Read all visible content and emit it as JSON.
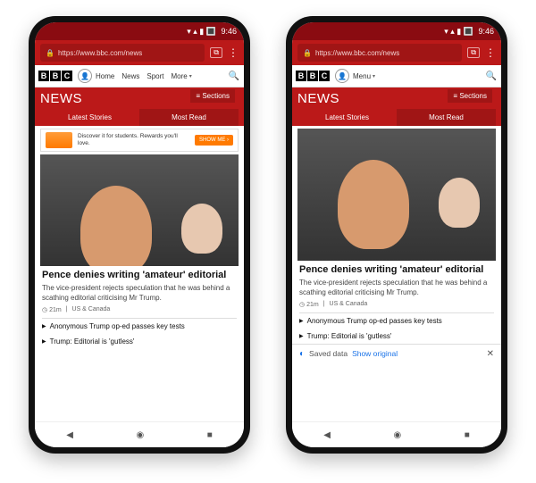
{
  "status": {
    "time": "9:46",
    "icons": "▾ ▴ ▮ 🔳"
  },
  "url": "https://www.bbc.com/news",
  "bbc_logo": [
    "B",
    "B",
    "C"
  ],
  "left": {
    "nav_items": [
      "Home",
      "News",
      "Sport",
      "More"
    ],
    "news_label": "NEWS",
    "sections_label": "Sections",
    "tabs": {
      "latest": "Latest Stories",
      "mostread": "Most Read"
    },
    "ad": {
      "headline": "Discover it for students. Rewards you'll love.",
      "cta": "SHOW ME ›"
    },
    "article": {
      "title": "Pence denies writing 'amateur' editorial",
      "summary": "The vice-president rejects speculation that he was behind a scathing editorial criticising Mr Trump.",
      "time": "21m",
      "section": "US & Canada"
    },
    "related1": "Anonymous Trump op-ed passes key tests",
    "related2": "Trump: Editorial is 'gutless'"
  },
  "right": {
    "nav_menu": "Menu",
    "news_label": "NEWS",
    "sections_label": "Sections",
    "tabs": {
      "latest": "Latest Stories",
      "mostread": "Most Read"
    },
    "article": {
      "title": "Pence denies writing 'amateur' editorial",
      "summary": "The vice-president rejects speculation that he was behind a scathing editorial criticising Mr Trump.",
      "time": "21m",
      "section": "US & Canada"
    },
    "related1": "Anonymous Trump op-ed passes key tests",
    "related2": "Trump: Editorial is 'gutless'",
    "saved": {
      "label": "Saved data",
      "link": "Show original"
    }
  }
}
